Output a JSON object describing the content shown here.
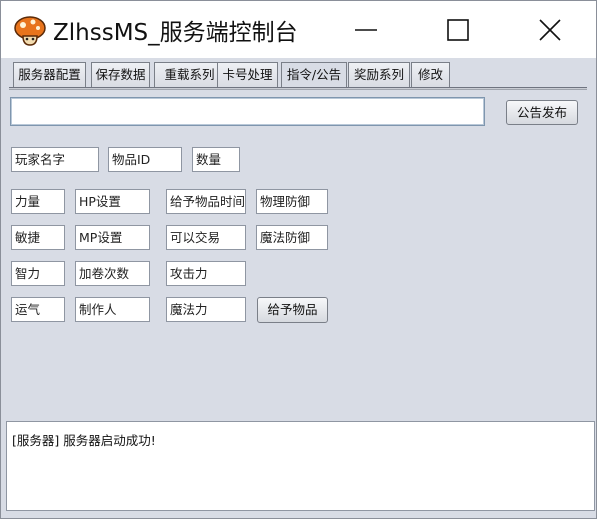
{
  "window": {
    "title": "ZlhssMS_服务端控制台"
  },
  "tabs": [
    {
      "label": "服务器配置"
    },
    {
      "label": "保存数据"
    },
    {
      "label": "重载系列"
    },
    {
      "label": "卡号处理"
    },
    {
      "label": "指令/公告"
    },
    {
      "label": "奖励系列"
    },
    {
      "label": "修改"
    }
  ],
  "announcement": {
    "value": "",
    "publish_label": "公告发布"
  },
  "fields": {
    "player_name": "玩家名字",
    "item_id": "物品ID",
    "quantity": "数量",
    "strength": "力量",
    "hp_setting": "HP设置",
    "give_item_time": "给予物品时间",
    "physical_defense": "物理防御",
    "agility": "敏捷",
    "mp_setting": "MP设置",
    "tradable": "可以交易",
    "magic_defense": "魔法防御",
    "intelligence": "智力",
    "scroll_count": "加卷次数",
    "attack": "攻击力",
    "luck": "运气",
    "creator": "制作人",
    "magic_attack": "魔法力"
  },
  "give_item_label": "给予物品",
  "log": {
    "line1": "[服务器] 服务器启动成功!"
  },
  "colors": {
    "background": "#d8dce5",
    "titlebar": "#ffffff"
  }
}
